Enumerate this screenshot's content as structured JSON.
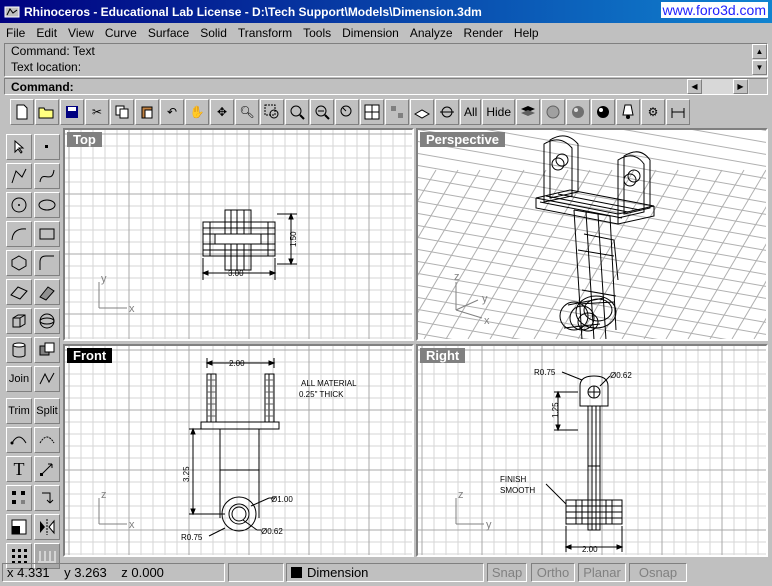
{
  "window": {
    "title": "Rhinoceros - Educational Lab License - D:\\Tech Support\\Models\\Dimension.3dm",
    "watermark": "www.foro3d.com"
  },
  "menu": [
    "File",
    "Edit",
    "View",
    "Curve",
    "Surface",
    "Solid",
    "Transform",
    "Tools",
    "Dimension",
    "Analyze",
    "Render",
    "Help"
  ],
  "command_history": [
    "Command: Text",
    "Text location:"
  ],
  "command_prompt": "Command:",
  "toolbar": {
    "all_label": "All",
    "hide_label": "Hide"
  },
  "left_tools": {
    "join": "Join",
    "trim": "Trim",
    "split": "Split"
  },
  "viewports": {
    "top": {
      "label": "Top",
      "dim_width": "3.00",
      "dim_height": "1.50",
      "axis_x": "x",
      "axis_y": "y"
    },
    "perspective": {
      "label": "Perspective",
      "axis_x": "x",
      "axis_y": "y",
      "axis_z": "z"
    },
    "front": {
      "label": "Front",
      "dim_top": "2.00",
      "dim_side": "3.25",
      "diam_outer": "Ø1.00",
      "diam_inner": "Ø0.62",
      "radius": "R0.75",
      "note_line1": "ALL MATERIAL",
      "note_line2": "0.25\" THICK",
      "axis_x": "x",
      "axis_z": "z"
    },
    "right": {
      "label": "Right",
      "radius": "R0.75",
      "diameter": "Ø0.62",
      "dim_side": "1.25",
      "dim_bottom": "2.00",
      "note_line1": "FINISH",
      "note_line2": "SMOOTH",
      "axis_y": "y",
      "axis_z": "z"
    }
  },
  "status": {
    "x_label": "x",
    "x_value": "4.331",
    "y_label": "y",
    "y_value": "3.263",
    "z_label": "z",
    "z_value": "0.000",
    "layer": "Dimension",
    "snap": "Snap",
    "ortho": "Ortho",
    "planar": "Planar",
    "osnap": "Osnap"
  },
  "colors": {
    "title_bar": "#000080",
    "active_label": "#000000",
    "inactive_label": "#808080",
    "grid_minor": "#d0d0d0",
    "grid_major": "#a0a0a0"
  }
}
